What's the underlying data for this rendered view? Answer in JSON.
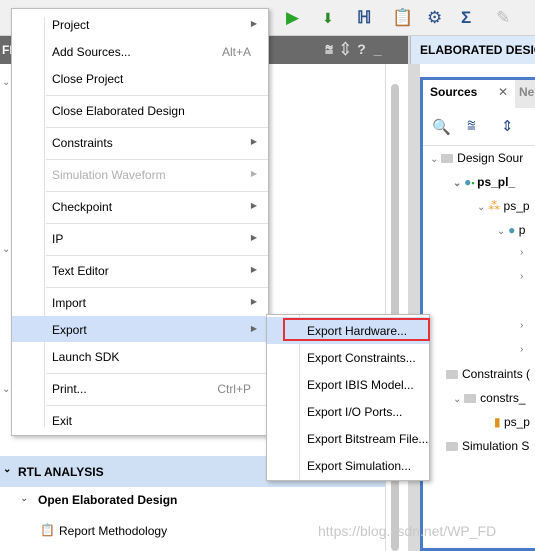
{
  "left_panel": {
    "title": "FI",
    "header_icons": [
      "collapse-all-icon",
      "expand-icon",
      "help-icon",
      "minimize-icon"
    ]
  },
  "right_panel": {
    "title": "ELABORATED DESIGN",
    "tabs": [
      {
        "label": "Sources",
        "active": true
      },
      {
        "label": "Ne"
      }
    ],
    "tree": [
      {
        "label": "Design Sour",
        "level": 0
      },
      {
        "label": "ps_pl_",
        "level": 1,
        "bold": true
      },
      {
        "label": "ps_p",
        "level": 2
      },
      {
        "label": "p",
        "level": 3
      },
      {
        "label": "Constraints (",
        "level": 0
      },
      {
        "label": "constrs_",
        "level": 1
      },
      {
        "label": "ps_p",
        "level": 2
      },
      {
        "label": "Simulation S",
        "level": 0
      }
    ]
  },
  "flow": {
    "section": "RTL ANALYSIS",
    "item": "Open Elaborated Design",
    "subitem": "Report Methodology"
  },
  "menu": {
    "items": [
      {
        "label": "Project",
        "submenu": true
      },
      {
        "label": "Add Sources...",
        "shortcut": "Alt+A"
      },
      {
        "label": "Close Project"
      },
      {
        "label": "Close Elaborated Design"
      },
      {
        "label": "Constraints",
        "submenu": true
      },
      {
        "label": "Simulation Waveform",
        "submenu": true,
        "disabled": true
      },
      {
        "label": "Checkpoint",
        "submenu": true
      },
      {
        "label": "IP",
        "submenu": true
      },
      {
        "label": "Text Editor",
        "submenu": true
      },
      {
        "label": "Import",
        "submenu": true
      },
      {
        "label": "Export",
        "submenu": true,
        "highlighted": true
      },
      {
        "label": "Launch SDK"
      },
      {
        "label": "Print...",
        "shortcut": "Ctrl+P"
      },
      {
        "label": "Exit"
      }
    ]
  },
  "export_submenu": {
    "items": [
      {
        "label": "Export Hardware...",
        "highlighted": true
      },
      {
        "label": "Export Constraints..."
      },
      {
        "label": "Export IBIS Model..."
      },
      {
        "label": "Export I/O Ports..."
      },
      {
        "label": "Export Bitstream File..."
      },
      {
        "label": "Export Simulation..."
      }
    ]
  },
  "colors": {
    "highlight": "#cfe0f8",
    "annotation_box": "#e8303a",
    "panel_border": "#4b7bc8"
  },
  "watermark": "https://blog.csdn.net/WP_FD"
}
